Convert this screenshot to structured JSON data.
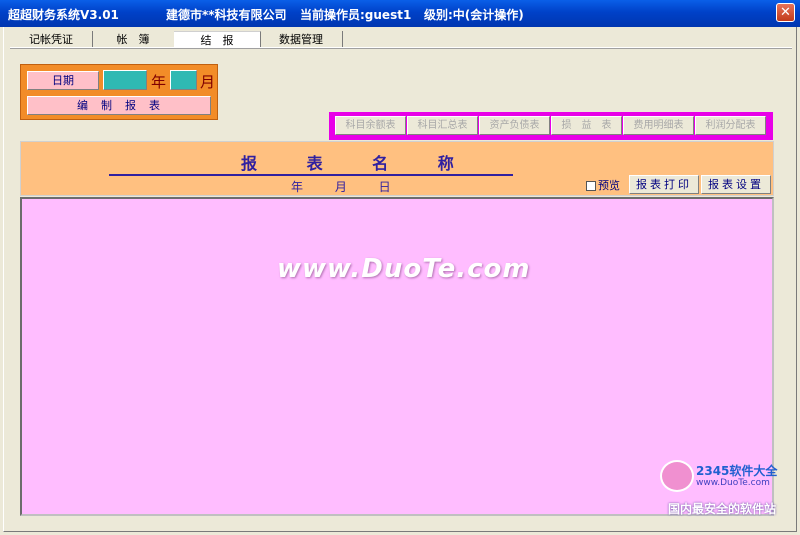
{
  "window": {
    "app_title": "超超财务系统V3.01",
    "company": "建德市**科技有限公司",
    "operator": "当前操作员:guest1",
    "level": "级别:中(会计操作)",
    "close_glyph": "✕"
  },
  "tabs": [
    "记帐凭证",
    "帐　簿",
    "结　报",
    "数据管理"
  ],
  "active_tab": "结　报",
  "date_panel": {
    "date_label": "日期",
    "year_unit": "年",
    "month_unit": "月",
    "compile_label": "编　制　报　表"
  },
  "report_buttons": [
    "科目余额表",
    "科目汇总表",
    "资产负债表",
    "损　益　表",
    "费用明细表",
    "利润分配表"
  ],
  "report": {
    "title": "报 表 名 称",
    "date_line": "年 月 日",
    "preview_label": "预览",
    "preview_checked": false,
    "print_label": "报表打印",
    "settings_label": "报表设置"
  },
  "watermark": {
    "text": "www.DuoTe.com",
    "logo_name": "2345软件大全",
    "logo_url": "www.DuoTe.com",
    "slogan": "国内最安全的软件站"
  },
  "colors": {
    "titlebar": "#0041c8",
    "date_panel": "#f28c28",
    "report_bar": "#e800e8",
    "report_header": "#ffc080",
    "content": "#ffbdff"
  }
}
